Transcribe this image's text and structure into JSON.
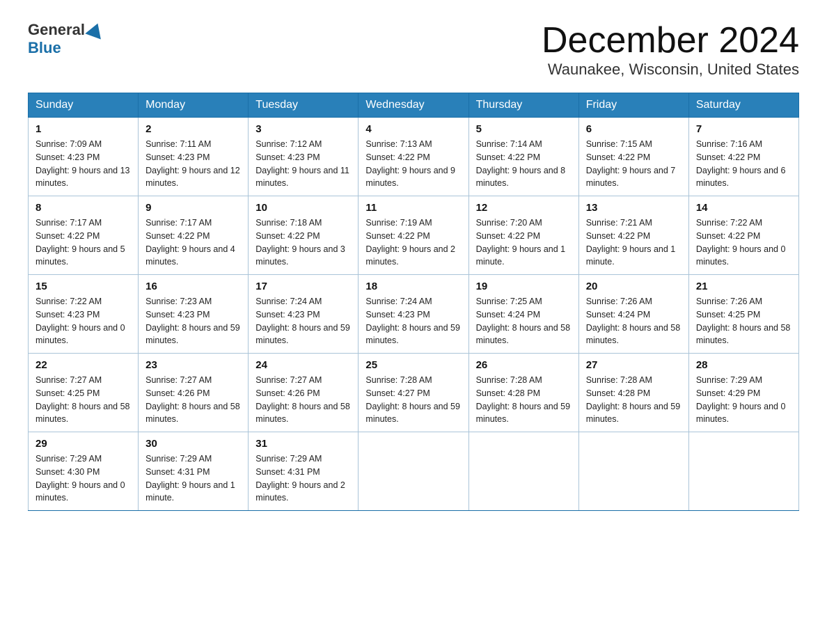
{
  "header": {
    "month_title": "December 2024",
    "location": "Waunakee, Wisconsin, United States",
    "logo_general": "General",
    "logo_blue": "Blue"
  },
  "weekdays": [
    "Sunday",
    "Monday",
    "Tuesday",
    "Wednesday",
    "Thursday",
    "Friday",
    "Saturday"
  ],
  "weeks": [
    [
      {
        "day": "1",
        "sunrise": "7:09 AM",
        "sunset": "4:23 PM",
        "daylight": "9 hours and 13 minutes."
      },
      {
        "day": "2",
        "sunrise": "7:11 AM",
        "sunset": "4:23 PM",
        "daylight": "9 hours and 12 minutes."
      },
      {
        "day": "3",
        "sunrise": "7:12 AM",
        "sunset": "4:23 PM",
        "daylight": "9 hours and 11 minutes."
      },
      {
        "day": "4",
        "sunrise": "7:13 AM",
        "sunset": "4:22 PM",
        "daylight": "9 hours and 9 minutes."
      },
      {
        "day": "5",
        "sunrise": "7:14 AM",
        "sunset": "4:22 PM",
        "daylight": "9 hours and 8 minutes."
      },
      {
        "day": "6",
        "sunrise": "7:15 AM",
        "sunset": "4:22 PM",
        "daylight": "9 hours and 7 minutes."
      },
      {
        "day": "7",
        "sunrise": "7:16 AM",
        "sunset": "4:22 PM",
        "daylight": "9 hours and 6 minutes."
      }
    ],
    [
      {
        "day": "8",
        "sunrise": "7:17 AM",
        "sunset": "4:22 PM",
        "daylight": "9 hours and 5 minutes."
      },
      {
        "day": "9",
        "sunrise": "7:17 AM",
        "sunset": "4:22 PM",
        "daylight": "9 hours and 4 minutes."
      },
      {
        "day": "10",
        "sunrise": "7:18 AM",
        "sunset": "4:22 PM",
        "daylight": "9 hours and 3 minutes."
      },
      {
        "day": "11",
        "sunrise": "7:19 AM",
        "sunset": "4:22 PM",
        "daylight": "9 hours and 2 minutes."
      },
      {
        "day": "12",
        "sunrise": "7:20 AM",
        "sunset": "4:22 PM",
        "daylight": "9 hours and 1 minute."
      },
      {
        "day": "13",
        "sunrise": "7:21 AM",
        "sunset": "4:22 PM",
        "daylight": "9 hours and 1 minute."
      },
      {
        "day": "14",
        "sunrise": "7:22 AM",
        "sunset": "4:22 PM",
        "daylight": "9 hours and 0 minutes."
      }
    ],
    [
      {
        "day": "15",
        "sunrise": "7:22 AM",
        "sunset": "4:23 PM",
        "daylight": "9 hours and 0 minutes."
      },
      {
        "day": "16",
        "sunrise": "7:23 AM",
        "sunset": "4:23 PM",
        "daylight": "8 hours and 59 minutes."
      },
      {
        "day": "17",
        "sunrise": "7:24 AM",
        "sunset": "4:23 PM",
        "daylight": "8 hours and 59 minutes."
      },
      {
        "day": "18",
        "sunrise": "7:24 AM",
        "sunset": "4:23 PM",
        "daylight": "8 hours and 59 minutes."
      },
      {
        "day": "19",
        "sunrise": "7:25 AM",
        "sunset": "4:24 PM",
        "daylight": "8 hours and 58 minutes."
      },
      {
        "day": "20",
        "sunrise": "7:26 AM",
        "sunset": "4:24 PM",
        "daylight": "8 hours and 58 minutes."
      },
      {
        "day": "21",
        "sunrise": "7:26 AM",
        "sunset": "4:25 PM",
        "daylight": "8 hours and 58 minutes."
      }
    ],
    [
      {
        "day": "22",
        "sunrise": "7:27 AM",
        "sunset": "4:25 PM",
        "daylight": "8 hours and 58 minutes."
      },
      {
        "day": "23",
        "sunrise": "7:27 AM",
        "sunset": "4:26 PM",
        "daylight": "8 hours and 58 minutes."
      },
      {
        "day": "24",
        "sunrise": "7:27 AM",
        "sunset": "4:26 PM",
        "daylight": "8 hours and 58 minutes."
      },
      {
        "day": "25",
        "sunrise": "7:28 AM",
        "sunset": "4:27 PM",
        "daylight": "8 hours and 59 minutes."
      },
      {
        "day": "26",
        "sunrise": "7:28 AM",
        "sunset": "4:28 PM",
        "daylight": "8 hours and 59 minutes."
      },
      {
        "day": "27",
        "sunrise": "7:28 AM",
        "sunset": "4:28 PM",
        "daylight": "8 hours and 59 minutes."
      },
      {
        "day": "28",
        "sunrise": "7:29 AM",
        "sunset": "4:29 PM",
        "daylight": "9 hours and 0 minutes."
      }
    ],
    [
      {
        "day": "29",
        "sunrise": "7:29 AM",
        "sunset": "4:30 PM",
        "daylight": "9 hours and 0 minutes."
      },
      {
        "day": "30",
        "sunrise": "7:29 AM",
        "sunset": "4:31 PM",
        "daylight": "9 hours and 1 minute."
      },
      {
        "day": "31",
        "sunrise": "7:29 AM",
        "sunset": "4:31 PM",
        "daylight": "9 hours and 2 minutes."
      },
      null,
      null,
      null,
      null
    ]
  ]
}
